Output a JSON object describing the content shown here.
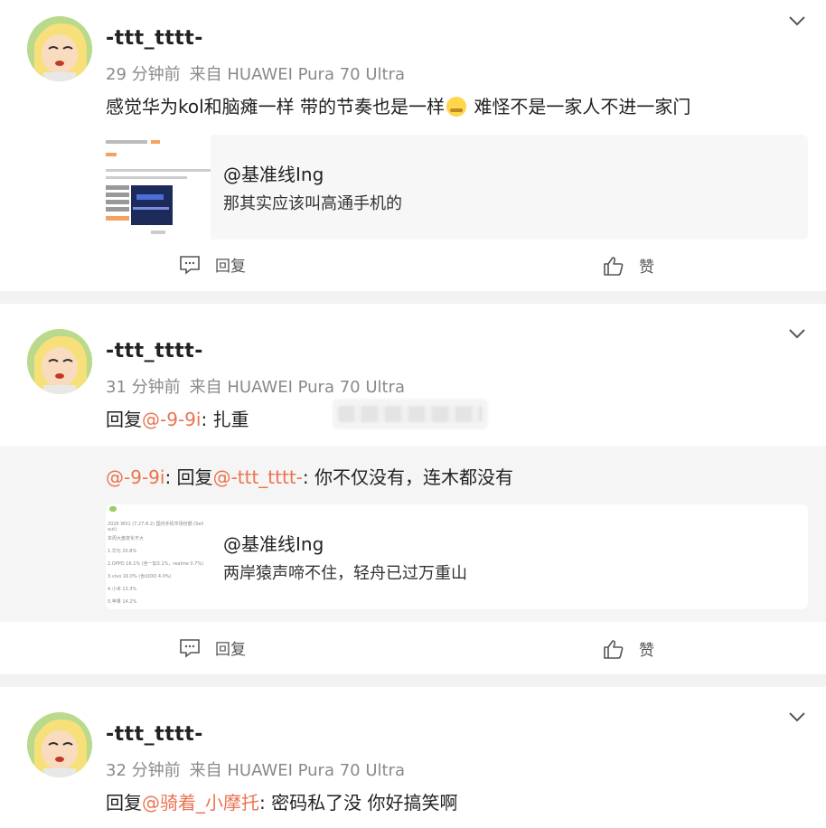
{
  "posts": [
    {
      "username": "-ttt_tttt-",
      "time": "29 分钟前",
      "source": "来自 HUAWEI Pura 70 Ultra",
      "text_before": "感觉华为kol和脑瘫一样 带的节奏也是一样",
      "text_after": " 难怪不是一家人不进一家门",
      "quote": {
        "author": "@基准线Ing",
        "text": "那其实应该叫高通手机的"
      },
      "reply_label": "回复",
      "like_label": "赞"
    },
    {
      "username": "-ttt_tttt-",
      "time": "31 分钟前",
      "source": "来自 HUAWEI Pura 70 Ultra",
      "reply_prefix": "回复",
      "mention": "@-9-9i",
      "text": ": 扎重",
      "sub": {
        "mention1": "@-9-9i",
        "mid": ": 回复",
        "mention2": "@-ttt_tttt-",
        "text": ": 你不仅没有，连木都没有"
      },
      "quote": {
        "author": "@基准线Ing",
        "text": "两岸猿声啼不住，轻舟已过万重山"
      },
      "reply_label": "回复",
      "like_label": "赞"
    },
    {
      "username": "-ttt_tttt-",
      "time": "32 分钟前",
      "source": "来自 HUAWEI Pura 70 Ultra",
      "reply_prefix": "回复",
      "mention": "@骑着_小摩托",
      "text": ": 密码私了没 你好搞笑啊"
    }
  ],
  "thumb2_lines": [
    "2026 W31 (7.27-8.2) 国内手机市场份额 (Sell out)",
    "本周大盘变化不大",
    "1.华为 20.8%",
    "2.OPPO 16.1% (含一加3.1%，realme 0.7%)",
    "3.vivo 16.0% (含iQOO 4.0%)",
    "4.小米 13.3%",
    "5.苹果 14.2%"
  ],
  "colors": {
    "link": "#eb7350",
    "meta": "#8a8a8a",
    "background": "#f2f2f2"
  }
}
